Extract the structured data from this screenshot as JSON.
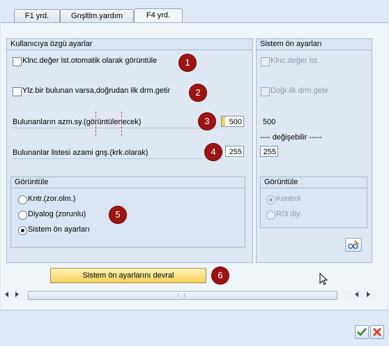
{
  "tabs": [
    {
      "label": "F1 yrd."
    },
    {
      "label": "Gnşltlm.yardım"
    },
    {
      "label": "F4 yrd."
    }
  ],
  "user_settings": {
    "title": "Kullanıcıya özgü ayarlar",
    "auto_display_label": "Klnc.değer lst.otomatik olarak görüntüle",
    "direct_label": "Ylz.bir bulunan varsa,doğrudan ilk drm.getir",
    "max_hits_label": "Bulunanların azm.sy.(görüntülenecek)",
    "max_hits_value": "500",
    "max_width_label": "Bulunanlar listesi azami gnş.(krk.olarak)",
    "max_width_value": "255",
    "display_title": "Görüntüle",
    "display_options": [
      {
        "label": "Kntr.(zor.olm.)",
        "selected": false
      },
      {
        "label": "Diyalog (zorunlu)",
        "selected": false
      },
      {
        "label": "Sistem ön ayarları",
        "selected": true
      }
    ]
  },
  "system_settings": {
    "title": "Sistem ön ayarları",
    "value_list_label": "Klnc.değer lst.",
    "direct_label": "Doğr.ilk drm.getir",
    "max_hits_value": "500",
    "changeable_label": "---- değişebilir -----",
    "max_width_value": "255",
    "display_title": "Görüntüle",
    "display_options": [
      {
        "label": "Kontrol",
        "selected": true
      },
      {
        "label": "R/3 diy.",
        "selected": false
      }
    ]
  },
  "badges": [
    "1",
    "2",
    "3",
    "4",
    "5",
    "6"
  ],
  "adopt_button_label": "Sistem ön ayarlarını devral",
  "footer": {
    "confirm_icon": "checkmark-icon",
    "cancel_icon": "cross-icon"
  },
  "colors": {
    "badge": "#9b1414",
    "button": "#f5cf5c",
    "confirm": "#2e8b2e",
    "cancel": "#d93a1a"
  }
}
